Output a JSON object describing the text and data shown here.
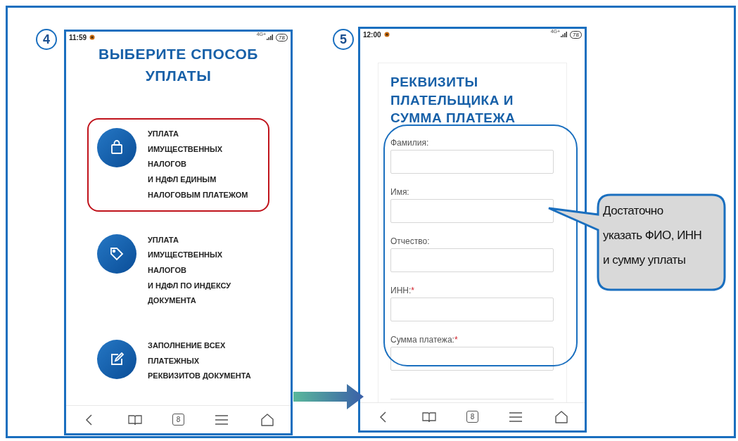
{
  "screens": [
    {
      "step": "4",
      "status_bar": {
        "time": "11:59",
        "network": "4G+",
        "battery": "78"
      },
      "title": "ВЫБЕРИТЕ СПОСОБ\nУПЛАТЫ",
      "options": [
        {
          "kind": "bag",
          "text": "УПЛАТА\nИМУЩЕСТВЕННЫХ\nНАЛОГОВ\nИ НДФЛ ЕДИНЫМ\nНАЛОГОВЫМ ПЛАТЕЖОМ",
          "selected": true
        },
        {
          "kind": "tag",
          "text": "УПЛАТА\nИМУЩЕСТВЕННЫХ\nНАЛОГОВ\nИ НДФЛ ПО ИНДЕКСУ\nДОКУМЕНТА",
          "selected": false
        },
        {
          "kind": "edit",
          "text": "ЗАПОЛНЕНИЕ ВСЕХ\nПЛАТЕЖНЫХ\nРЕКВИЗИТОВ ДОКУМЕНТА",
          "selected": false
        }
      ],
      "tab_count": "8"
    },
    {
      "step": "5",
      "status_bar": {
        "time": "12:00",
        "network": "4G+",
        "battery": "78"
      },
      "title": "РЕКВИЗИТЫ\nПЛАТЕЛЬЩИКА И\nСУММА ПЛАТЕЖА",
      "fields": [
        {
          "label": "Фамилия:"
        },
        {
          "label": "Имя:"
        },
        {
          "label": "Отчество:"
        },
        {
          "label": "ИНН:",
          "required_marker": "*"
        },
        {
          "label": "Сумма платежа:",
          "required_marker": "*"
        }
      ],
      "tab_count": "8"
    }
  ],
  "callout": "Достаточно\nуказать ФИО, ИНН\nи сумму уплаты"
}
